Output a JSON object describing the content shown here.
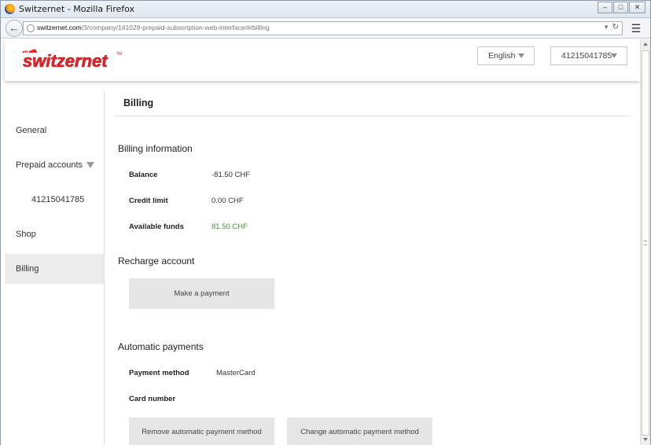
{
  "window": {
    "title": "Switzernet - Mozilla Firefox",
    "minimize_icon": "minimize-icon",
    "maximize_icon": "maximize-icon",
    "close_icon": "close-icon"
  },
  "browser": {
    "url_domain": "switzernet.com",
    "url_path": "/3/company/141029-prepaid-subscription-web-interface/#/billing"
  },
  "header": {
    "logo_text": "switzernet",
    "language": "English",
    "account": "41215041785"
  },
  "sidebar": {
    "items": [
      {
        "label": "General"
      },
      {
        "label": "Prepaid accounts"
      },
      {
        "label": "41215041785"
      },
      {
        "label": "Shop"
      },
      {
        "label": "Billing"
      }
    ]
  },
  "main": {
    "page_title": "Billing",
    "billing_info": {
      "title": "Billing information",
      "balance_label": "Balance",
      "balance_value": "-81.50 CHF",
      "credit_label": "Credit limit",
      "credit_value": "0.00 CHF",
      "funds_label": "Available funds",
      "funds_value": "81.50 CHF"
    },
    "recharge": {
      "title": "Recharge account",
      "pay_button": "Make a payment"
    },
    "auto": {
      "title": "Automatic payments",
      "method_label": "Payment method",
      "method_value": "MasterCard",
      "card_label": "Card number",
      "remove_button": "Remove automatic payment method",
      "change_button": "Change automatic payment method"
    }
  },
  "colors": {
    "accent_red": "#e8242b",
    "funds_green": "#3d9a2a",
    "active_item_bg": "#ececec"
  }
}
